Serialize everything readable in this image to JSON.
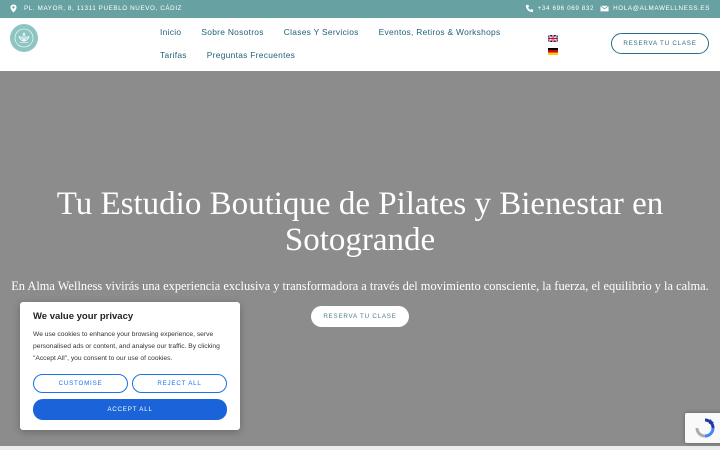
{
  "topbar": {
    "address": "Pl. Mayor, 8, 11311 Pueblo Nuevo, Cádiz",
    "phone": "+34 696 069 832",
    "email": "hola@almawellness.es"
  },
  "nav": {
    "row1": [
      "Inicio",
      "Sobre Nosotros",
      "Clases Y Servicios",
      "Eventos, Retiros & Workshops"
    ],
    "row2": [
      "Tarifas",
      "Preguntas Frecuentes"
    ]
  },
  "header": {
    "cta_label": "Reserva tu clase"
  },
  "hero": {
    "title": "Tu Estudio Boutique de Pilates y Bienestar en Sotogrande",
    "subtitle": "En Alma Wellness vivirás una experiencia exclusiva y transformadora a través del movimiento consciente, la fuerza, el equilibrio y la calma.",
    "cta_label": "Reserva tu clase"
  },
  "cookie": {
    "title": "We value your privacy",
    "body": "We use cookies to enhance your browsing experience, serve personalised ads or content, and analyse our traffic. By clicking \"Accept All\", you consent to our use of cookies.",
    "customise": "Customise",
    "reject": "Reject All",
    "accept": "Accept All"
  },
  "colors": {
    "topbar": "#67a1a2",
    "nav_text": "#1f5f77",
    "hero_bg": "#8c8c8c",
    "accept_btn": "#1a63d8"
  },
  "icons": [
    "location-pin-icon",
    "phone-icon",
    "mail-icon",
    "logo-lotus-icon",
    "uk-flag-icon",
    "germany-flag-icon",
    "recaptcha-icon"
  ]
}
